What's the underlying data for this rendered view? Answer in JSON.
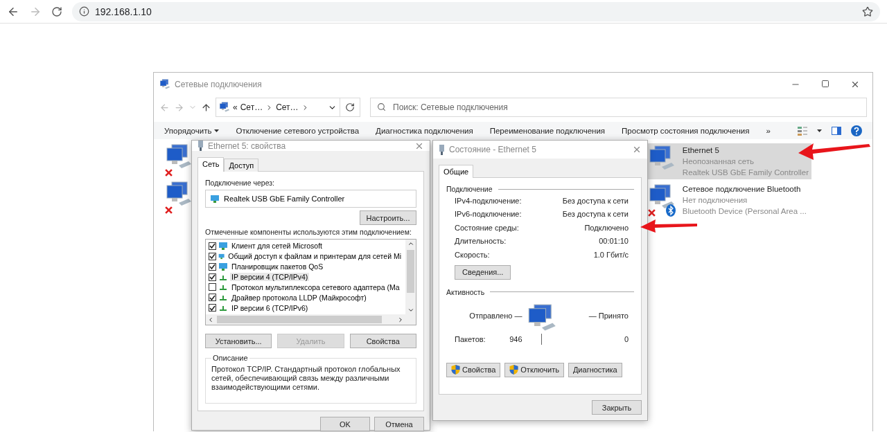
{
  "browser": {
    "url": "192.168.1.10"
  },
  "explorer": {
    "title": "Сетевые подключения",
    "address": [
      "«",
      "Сет…",
      "Сет…"
    ],
    "search": {
      "placeholder": "Поиск: Сетевые подключения"
    },
    "toolbar": [
      {
        "label": "Упорядочить",
        "dropdown": true
      },
      {
        "label": "Отключение сетевого устройства",
        "dropdown": false
      },
      {
        "label": "Диагностика подключения",
        "dropdown": false
      },
      {
        "label": "Переименование подключения",
        "dropdown": false
      },
      {
        "label": "Просмотр состояния подключения",
        "dropdown": false
      }
    ],
    "more": "»",
    "covered_connections": [
      {
        "disconnected": true
      },
      {
        "disconnected": true
      }
    ],
    "connections": [
      {
        "kind": "ethernet",
        "name": "Ethernet 5",
        "status": "Неопознанная сеть",
        "device": "Realtek USB GbE Family Controller",
        "selected": true,
        "disconnected": false
      },
      {
        "kind": "bluetooth",
        "name": "Сетевое подключение Bluetooth",
        "status": "Нет подключения",
        "device": "Bluetooth Device (Personal Area ...",
        "selected": false,
        "disconnected": true
      }
    ]
  },
  "properties_dialog": {
    "title": "Ethernet 5: свойства",
    "tabs": [
      {
        "label": "Сеть",
        "selected": true
      },
      {
        "label": "Доступ",
        "selected": false
      }
    ],
    "connect_via_label": "Подключение через:",
    "adapter": "Realtek USB GbE Family Controller",
    "configure_button": "Настроить...",
    "components_label": "Отмеченные компоненты используются этим подключением:",
    "components": [
      {
        "kind": "client",
        "label": "Клиент для сетей Microsoft",
        "checked": true,
        "selected": false
      },
      {
        "kind": "client",
        "label": "Общий доступ к файлам и принтерам для сетей Mi",
        "checked": true,
        "selected": false
      },
      {
        "kind": "client",
        "label": "Планировщик пакетов QoS",
        "checked": true,
        "selected": false
      },
      {
        "kind": "protocol",
        "label": "IP версии 4 (TCP/IPv4)",
        "checked": true,
        "selected": true
      },
      {
        "kind": "protocol",
        "label": "Протокол мультиплексора сетевого адаптера (Ma",
        "checked": false,
        "selected": false
      },
      {
        "kind": "protocol",
        "label": "Драйвер протокола LLDP (Майкрософт)",
        "checked": true,
        "selected": false
      },
      {
        "kind": "protocol",
        "label": "IP версии 6 (TCP/IPv6)",
        "checked": true,
        "selected": false
      }
    ],
    "buttons": [
      {
        "label": "Установить...",
        "disabled": false
      },
      {
        "label": "Удалить",
        "disabled": true
      },
      {
        "label": "Свойства",
        "disabled": false
      }
    ],
    "description_title": "Описание",
    "description": "Протокол TCP/IP. Стандартный протокол глобальных сетей, обеспечивающий связь между различными взаимодействующими сетями.",
    "footer_buttons": [
      "OK",
      "Отмена"
    ]
  },
  "status_dialog": {
    "title": "Состояние - Ethernet 5",
    "tabs": [
      {
        "label": "Общие",
        "selected": true
      }
    ],
    "connection_heading": "Подключение",
    "rows": [
      {
        "label": "IPv4-подключение:",
        "value": "Без доступа к сети"
      },
      {
        "label": "IPv6-подключение:",
        "value": "Без доступа к сети"
      },
      {
        "label": "Состояние среды:",
        "value": "Подключено"
      },
      {
        "label": "Длительность:",
        "value": "00:01:10"
      },
      {
        "label": "Скорость:",
        "value": "1.0 Гбит/с"
      }
    ],
    "details_button": "Сведения...",
    "activity_heading": "Активность",
    "sent_label": "Отправлено —",
    "received_label": "— Принято",
    "packets_label": "Пакетов:",
    "packets_sent": "946",
    "packets_received": "0",
    "buttons": [
      {
        "label": "Свойства",
        "shield": true
      },
      {
        "label": "Отключить",
        "shield": true
      },
      {
        "label": "Диагностика",
        "shield": false
      }
    ],
    "close_button": "Закрыть"
  }
}
